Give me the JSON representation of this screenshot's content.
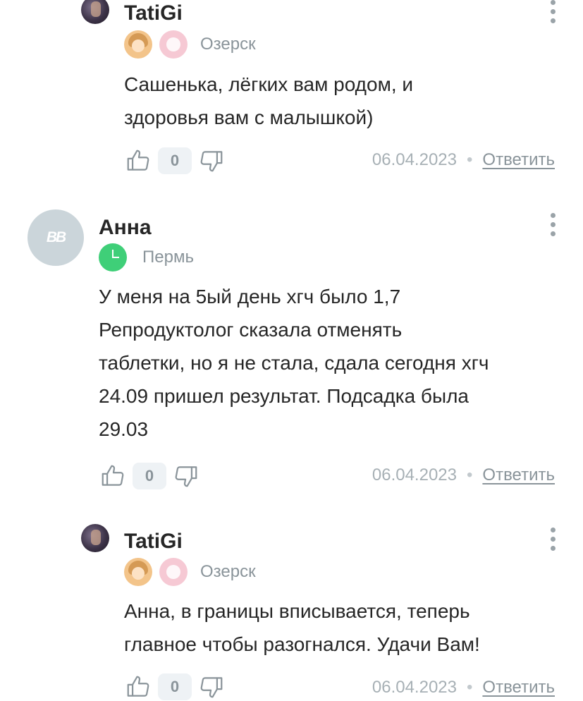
{
  "comments": [
    {
      "author": "TatiGi",
      "city": "Озерск",
      "text": "Сашенька, лёгких вам родом, и\nздоровья вам с малышкой)",
      "votes": "0",
      "date": "06.04.2023",
      "separator": "•",
      "reply_label": "Ответить",
      "avatar_icon": "user-photo",
      "badges": [
        "girl-face-icon",
        "baby-icon"
      ]
    },
    {
      "author": "Анна",
      "city": "Пермь",
      "initials": "ВВ",
      "text": "У меня на 5ый день хгч было 1,7\nРепродуктолог сказала отменять\nтаблетки, но я не стала, сдала сегодня хгч\n24.09 пришел результат. Подсадка была\n29.03",
      "votes": "0",
      "date": "06.04.2023",
      "separator": "•",
      "reply_label": "Ответить",
      "badges": [
        "clock-icon"
      ]
    },
    {
      "author": "TatiGi",
      "city": "Озерск",
      "text": "Анна, в границы вписывается, теперь\nглавное чтобы разогнался. Удачи Вам!",
      "votes": "0",
      "date": "06.04.2023",
      "separator": "•",
      "reply_label": "Ответить",
      "avatar_icon": "user-photo",
      "badges": [
        "girl-face-icon",
        "baby-icon"
      ]
    }
  ],
  "colors": {
    "badge_clock": "#3fcf78",
    "muted_text": "#8a949a",
    "vote_bg": "#eef2f5"
  }
}
